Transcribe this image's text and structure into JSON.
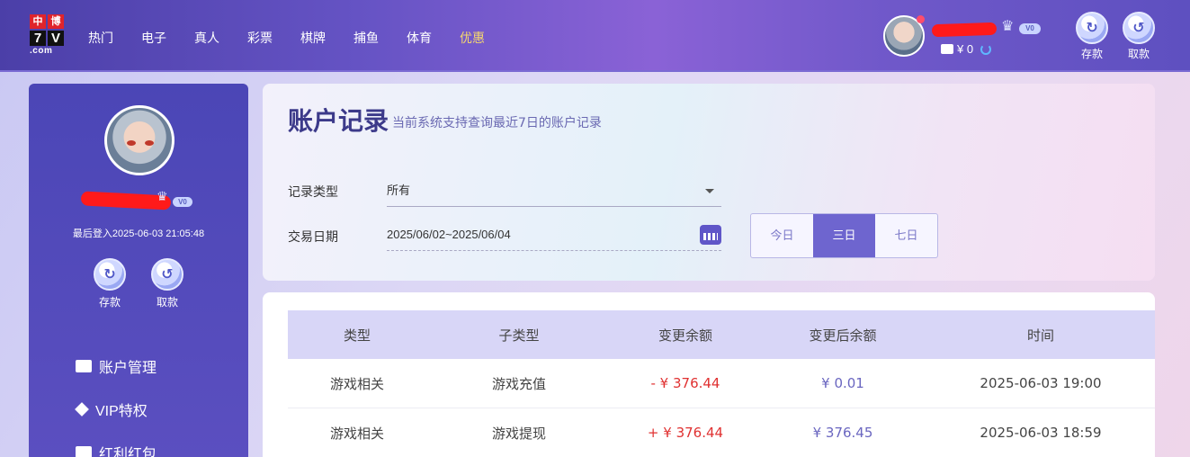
{
  "logo": {
    "cn": [
      "中",
      "博"
    ],
    "num": [
      "7",
      "V"
    ],
    "dotcom": ".com"
  },
  "nav": {
    "items": [
      "热门",
      "电子",
      "真人",
      "彩票",
      "棋牌",
      "捕鱼",
      "体育",
      "优惠"
    ],
    "active_index": 7
  },
  "top_user": {
    "balance": "¥ 0",
    "vip": "V0",
    "deposit_label": "存款",
    "withdraw_label": "取款"
  },
  "sidebar": {
    "vip": "V0",
    "last_login": "最后登入2025-06-03 21:05:48",
    "deposit_label": "存款",
    "withdraw_label": "取款",
    "menu": [
      "账户管理",
      "VIP特权",
      "红利红包"
    ]
  },
  "page": {
    "title": "账户记录",
    "subtitle": "当前系统支持查询最近7日的账户记录"
  },
  "filters": {
    "type_label": "记录类型",
    "type_value": "所有",
    "date_label": "交易日期",
    "date_value": "2025/06/02~2025/06/04",
    "ranges": [
      "今日",
      "三日",
      "七日"
    ],
    "active_range": "三日"
  },
  "table": {
    "headers": [
      "类型",
      "子类型",
      "变更余额",
      "变更后余额",
      "时间"
    ],
    "rows": [
      {
        "type": "游戏相关",
        "subtype": "游戏充值",
        "change": "- ¥ 376.44",
        "balance": "¥ 0.01",
        "time": "2025-06-03 19:00"
      },
      {
        "type": "游戏相关",
        "subtype": "游戏提现",
        "change": "+ ¥ 376.44",
        "balance": "¥ 376.45",
        "time": "2025-06-03 18:59"
      }
    ]
  },
  "colors": {
    "accent": "#6e65cf",
    "negative": "#e03131",
    "balance": "#6a66c0",
    "nav_active": "#f5d76e"
  }
}
